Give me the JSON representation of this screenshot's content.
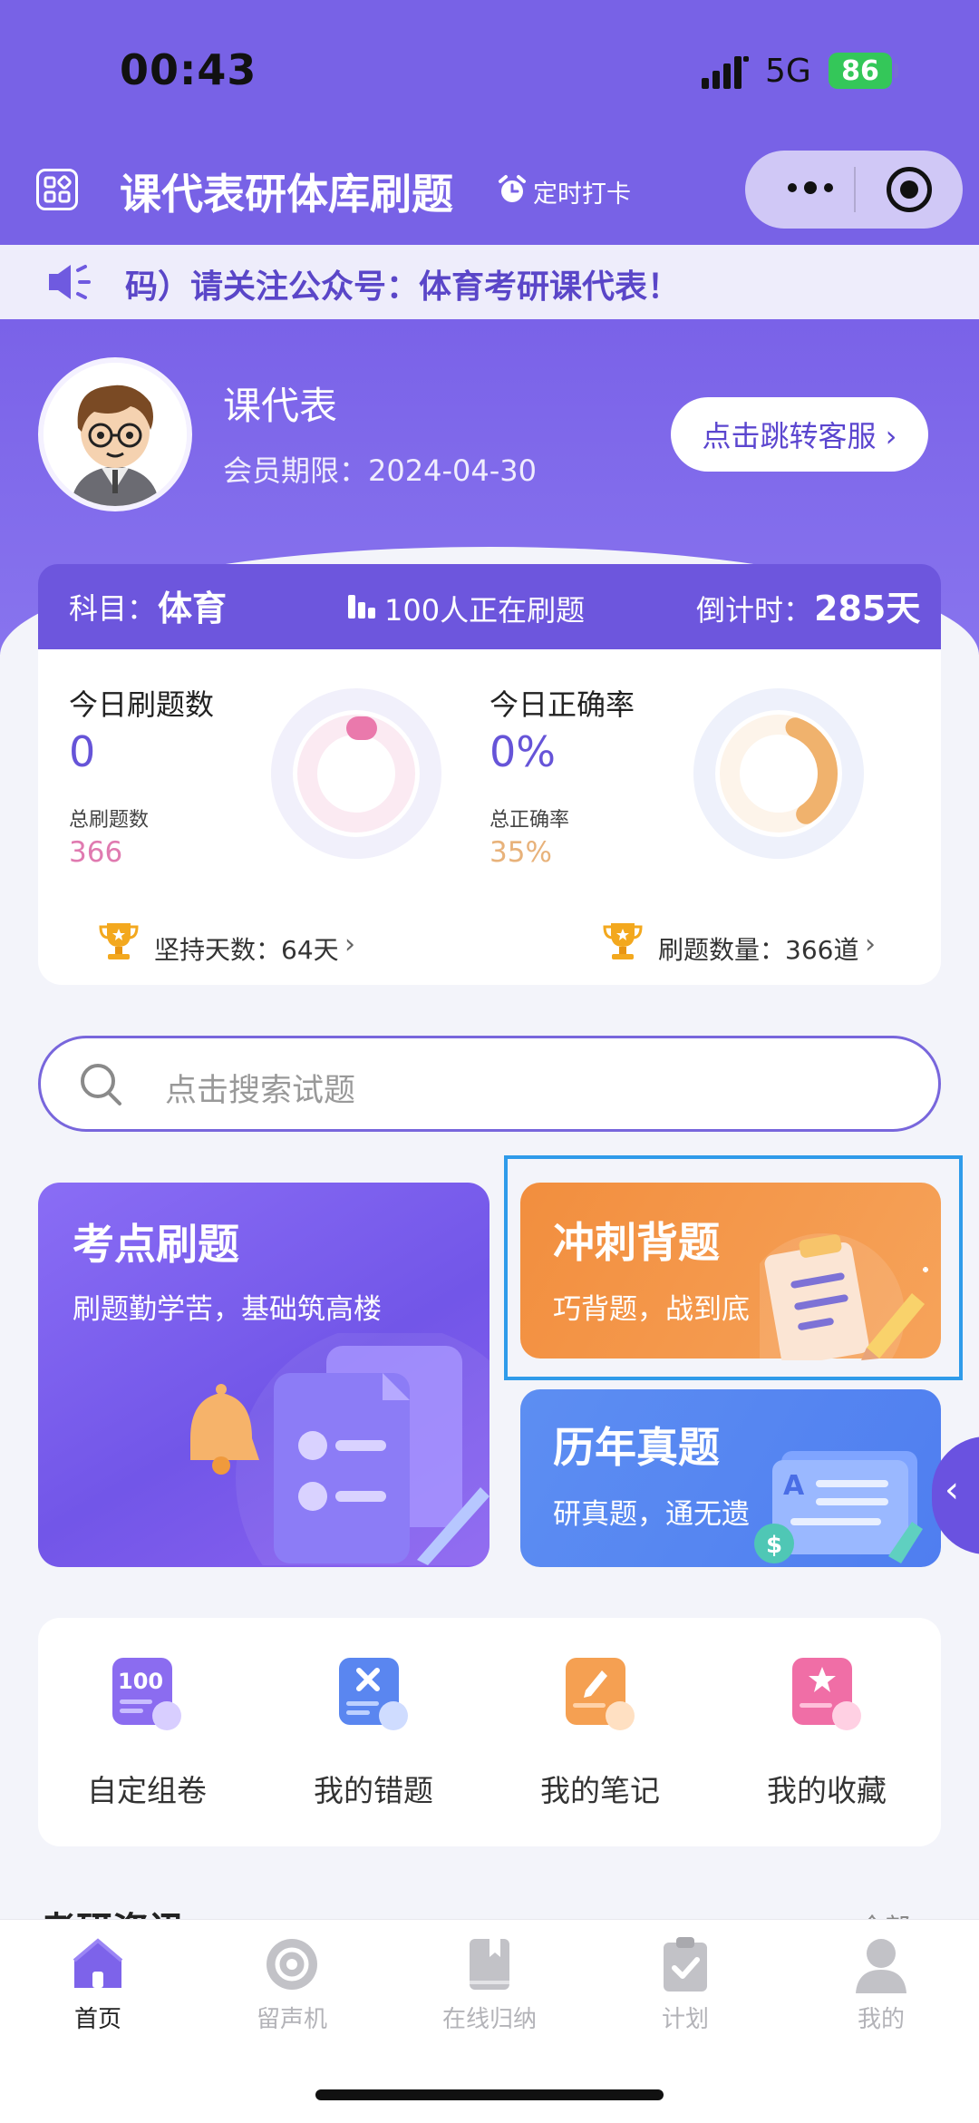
{
  "status_bar": {
    "time": "00:43",
    "network": "5G",
    "battery": "86"
  },
  "nav": {
    "title": "课代表研体库刷题",
    "alarm_label": "定时打卡"
  },
  "notice": {
    "text": "码）请关注公众号：体育考研课代表！"
  },
  "profile": {
    "name": "课代表",
    "member_expiry": "会员期限：2024-04-30",
    "service_button": "点击跳转客服 ›"
  },
  "stats": {
    "subject_label": "科目：",
    "subject_value": "体育",
    "active_users": "100人正在刷题",
    "countdown_label": "倒计时：",
    "countdown_value": "285天",
    "today_count_title": "今日刷题数",
    "today_count_value": "0",
    "total_count_title": "总刷题数",
    "total_count_value": "366",
    "today_rate_title": "今日正确率",
    "today_rate_value": "0%",
    "total_rate_title": "总正确率",
    "total_rate_value": "35%",
    "total_rate_fraction": 0.35,
    "streak_days": "坚持天数：64天",
    "question_quantity": "刷题数量：366道",
    "chevron": "›"
  },
  "search": {
    "placeholder": "点击搜索试题"
  },
  "cards": {
    "kaodian": {
      "title": "考点刷题",
      "subtitle": "刷题勤学苦，基础筑高楼"
    },
    "sprint": {
      "title": "冲刺背题",
      "subtitle": "巧背题，战到底"
    },
    "past": {
      "title": "历年真题",
      "subtitle": "研真题，通无遗"
    }
  },
  "tools": [
    {
      "label": "自定组卷",
      "icon": "100-paper-icon"
    },
    {
      "label": "我的错题",
      "icon": "wrong-x-icon"
    },
    {
      "label": "我的笔记",
      "icon": "note-pencil-icon"
    },
    {
      "label": "我的收藏",
      "icon": "star-bookmark-icon"
    }
  ],
  "news": {
    "heading": "考研资讯",
    "more": "全部 ›"
  },
  "tabbar": [
    {
      "label": "首页",
      "active": true
    },
    {
      "label": "留声机",
      "active": false
    },
    {
      "label": "在线归纳",
      "active": false
    },
    {
      "label": "计划",
      "active": false
    },
    {
      "label": "我的",
      "active": false
    }
  ],
  "colors": {
    "brand": "#7862e6",
    "sprint": "#f28e3e",
    "past": "#5d8ef2",
    "accent_pink": "#e07ab0",
    "accent_gold": "#e8b27a"
  }
}
